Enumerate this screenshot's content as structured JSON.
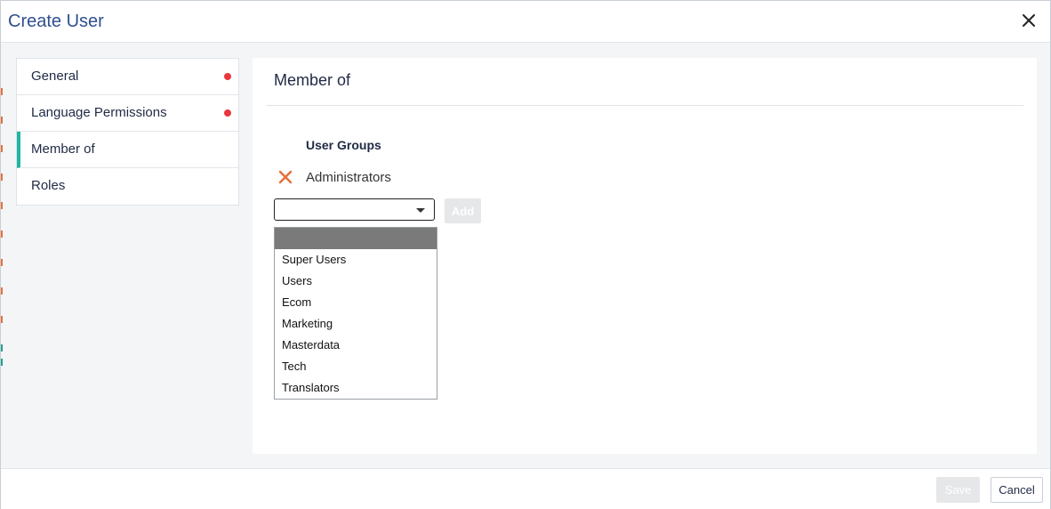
{
  "dialog": {
    "title": "Create User",
    "close_icon": "close-icon"
  },
  "sidebar": {
    "items": [
      {
        "label": "General",
        "has_error": true
      },
      {
        "label": "Language Permissions",
        "has_error": true
      },
      {
        "label": "Member of",
        "active": true
      },
      {
        "label": "Roles"
      }
    ]
  },
  "main": {
    "section_title": "Member of",
    "user_groups_label": "User Groups",
    "groups": [
      {
        "name": "Administrators",
        "remove_icon": "remove-x-icon"
      }
    ],
    "select": {
      "value": "",
      "options": [
        "",
        "Super Users",
        "Users",
        "Ecom",
        "Marketing",
        "Masterdata",
        "Tech",
        "Translators"
      ]
    },
    "add_label": "Add"
  },
  "footer": {
    "save_label": "Save",
    "cancel_label": "Cancel"
  },
  "colors": {
    "accent": "#21b5a3",
    "error_dot": "#e8383d",
    "remove_icon": "#e8703a",
    "title": "#2f4f8f"
  }
}
